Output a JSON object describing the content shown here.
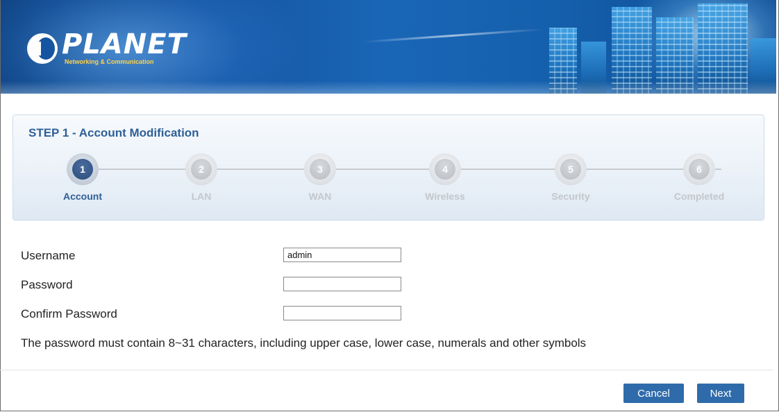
{
  "brand": {
    "logo_text": "PLANET",
    "tagline": "Networking & Communication"
  },
  "wizard": {
    "title": "STEP 1 - Account Modification",
    "steps": [
      {
        "number": "1",
        "label": "Account",
        "active": true
      },
      {
        "number": "2",
        "label": "LAN",
        "active": false
      },
      {
        "number": "3",
        "label": "WAN",
        "active": false
      },
      {
        "number": "4",
        "label": "Wireless",
        "active": false
      },
      {
        "number": "5",
        "label": "Security",
        "active": false
      },
      {
        "number": "6",
        "label": "Completed",
        "active": false
      }
    ]
  },
  "form": {
    "username_label": "Username",
    "username_value": "admin",
    "password_label": "Password",
    "password_value": "",
    "confirm_label": "Confirm Password",
    "confirm_value": "",
    "note": "The password must contain 8~31 characters, including upper case, lower case, numerals and other symbols"
  },
  "actions": {
    "cancel_label": "Cancel",
    "next_label": "Next"
  },
  "colors": {
    "accent": "#2f6baa",
    "title": "#2f5f96",
    "active_step": "#2c4d7d",
    "inactive_step": "#c3c7cc"
  }
}
